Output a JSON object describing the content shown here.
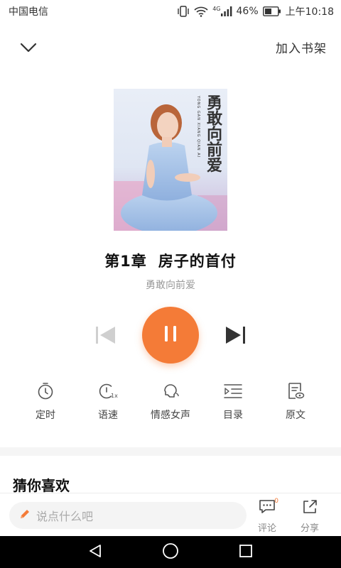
{
  "status_bar": {
    "carrier": "中国电信",
    "network": "4G",
    "battery": "46%",
    "time": "上午10:18"
  },
  "header": {
    "back_icon": "chevron-down-icon",
    "add_to_shelf": "加入书架"
  },
  "book": {
    "chapter_number": "第1章",
    "chapter_name": "房子的首付",
    "title": "勇敢向前爱",
    "cover_title": "勇敢向前爱",
    "cover_pinyin": "YONG GAN XIANG QIAN AI"
  },
  "player": {
    "state": "playing",
    "accent_color": "#f47b37",
    "prev_icon": "skip-previous-icon",
    "pause_icon": "pause-icon",
    "next_icon": "skip-next-icon"
  },
  "tools": [
    {
      "label": "定时",
      "icon": "timer-icon"
    },
    {
      "label": "语速",
      "icon": "speed-icon"
    },
    {
      "label": "情感女声",
      "icon": "voice-icon"
    },
    {
      "label": "目录",
      "icon": "catalog-icon"
    },
    {
      "label": "原文",
      "icon": "original-text-icon"
    }
  ],
  "recommend": {
    "title": "猜你喜欢"
  },
  "bottom_bar": {
    "comment_placeholder": "说点什么吧",
    "comment_label": "评论",
    "comment_count": "0",
    "share_label": "分享"
  }
}
